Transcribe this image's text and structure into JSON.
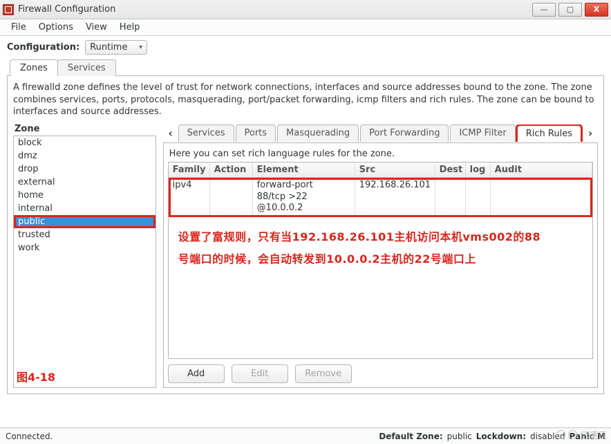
{
  "window": {
    "title": "Firewall Configuration"
  },
  "menus": {
    "file": "File",
    "options": "Options",
    "view": "View",
    "help": "Help"
  },
  "configLabel": "Configuration:",
  "configValue": "Runtime",
  "outerTabs": {
    "zones": "Zones",
    "services": "Services"
  },
  "zoneDescription": "A firewalld zone defines the level of trust for network connections, interfaces and source addresses bound to the zone. The zone combines services, ports, protocols, masquerading, port/packet forwarding, icmp filters and rich rules. The zone can be bound to interfaces and source addresses.",
  "zoneHeader": "Zone",
  "zones": {
    "block": "block",
    "dmz": "dmz",
    "drop": "drop",
    "external": "external",
    "home": "home",
    "internal": "internal",
    "public": "public",
    "trusted": "trusted",
    "work": "work"
  },
  "innerTabs": {
    "services": "Services",
    "ports": "Ports",
    "masq": "Masquerading",
    "pf": "Port Forwarding",
    "icmp": "ICMP Filter",
    "rich": "Rich Rules"
  },
  "richHint": "Here you can set rich language rules for the zone.",
  "columns": {
    "family": "Family",
    "action": "Action",
    "element": "Element",
    "src": "Src",
    "dest": "Dest",
    "log": "log",
    "audit": "Audit"
  },
  "rule0": {
    "family": "ipv4",
    "action": "",
    "element_l1": "forward-port",
    "element_l2": "88/tcp >22 @10.0.0.2",
    "src": "192.168.26.101",
    "dest": "",
    "log": "",
    "audit": ""
  },
  "annotation_l1": "设置了富规则，只有当192.168.26.101主机访问本机vms002的88",
  "annotation_l2": "号端口的时候，会自动转发到10.0.0.2主机的22号端口上",
  "figureLabel": "图4-18",
  "buttons": {
    "add": "Add",
    "edit": "Edit",
    "remove": "Remove"
  },
  "status": {
    "connected": "Connected.",
    "defZoneLabel": "Default Zone:",
    "defZoneValue": "public",
    "lockdownLabel": "Lockdown:",
    "lockdownValue": "disabled",
    "panicLabel": "Panic M"
  },
  "watermark": "亿速云"
}
